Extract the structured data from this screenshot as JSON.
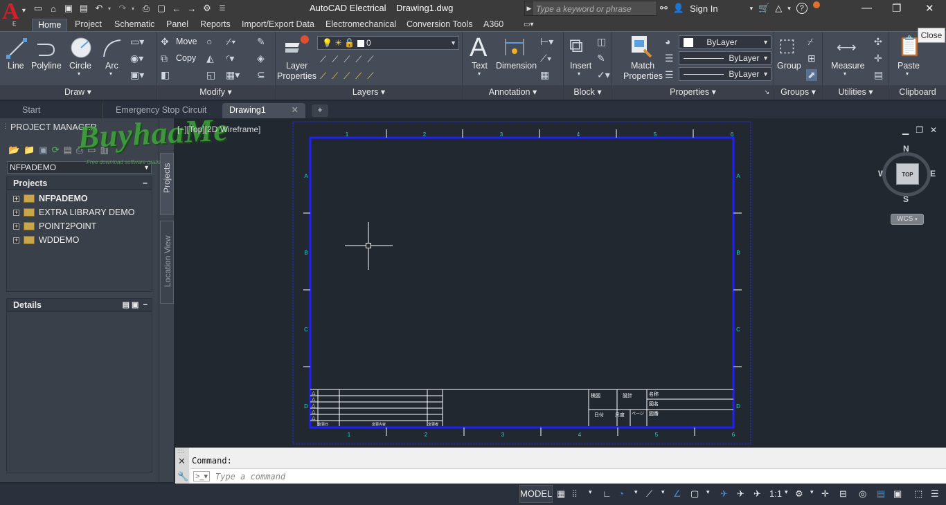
{
  "app": {
    "title": "AutoCAD Electrical    Drawing1.dwg",
    "logo_letter": "A",
    "logo_sub": "E"
  },
  "search": {
    "placeholder": "Type a keyword or phrase"
  },
  "user": {
    "sign_in": "Sign In"
  },
  "ribbon_tabs": [
    "Home",
    "Project",
    "Schematic",
    "Panel",
    "Reports",
    "Import/Export Data",
    "Electromechanical",
    "Conversion Tools",
    "A360"
  ],
  "ribbon": {
    "draw": {
      "title": "Draw",
      "line": "Line",
      "polyline": "Polyline",
      "circle": "Circle",
      "arc": "Arc"
    },
    "modify": {
      "title": "Modify",
      "move": "Move",
      "copy": "Copy"
    },
    "layers": {
      "title": "Layers",
      "layer_properties_1": "Layer",
      "layer_properties_2": "Properties",
      "current_layer": "0"
    },
    "annotation": {
      "title": "Annotation",
      "text": "Text",
      "dimension": "Dimension"
    },
    "block": {
      "title": "Block",
      "insert": "Insert"
    },
    "properties": {
      "title": "Properties",
      "match_1": "Match",
      "match_2": "Properties",
      "color": "ByLayer",
      "linetype": "ByLayer",
      "lineweight": "ByLayer"
    },
    "groups": {
      "title": "Groups",
      "group": "Group"
    },
    "utilities": {
      "title": "Utilities",
      "measure": "Measure"
    },
    "clipboard": {
      "title": "Clipboard",
      "paste": "Paste"
    },
    "close_tooltip": "Close"
  },
  "doc_tabs": [
    "Start",
    "Emergency Stop Circuit",
    "Drawing1"
  ],
  "project_manager": {
    "title": "PROJECT MANAGER",
    "selected_project": "NFPADEMO",
    "projects_header": "Projects",
    "projects": [
      "NFPADEMO",
      "EXTRA LIBRARY DEMO",
      "POINT2POINT",
      "WDDEMO"
    ],
    "details_header": "Details",
    "side_tab_projects": "Projects",
    "side_tab_location": "Location View"
  },
  "viewport": {
    "label": "[−][Top][2D Wireframe]",
    "viewcube_top": "TOP",
    "compass": {
      "n": "N",
      "s": "S",
      "e": "E",
      "w": "W"
    },
    "wcs": "WCS",
    "border_columns": [
      "1",
      "2",
      "3",
      "4",
      "5",
      "6"
    ],
    "border_rows": [
      "A",
      "B",
      "C",
      "D"
    ],
    "title_block": {
      "approved": "検図",
      "design": "設計",
      "name": "名称",
      "drawing_name": "図名",
      "date": "日付",
      "scale": "尺度",
      "page": "ページ",
      "number": "図番",
      "revision_symbols": [
        "△",
        "△",
        "△",
        "△",
        "△"
      ],
      "rev_headers": [
        "変更日",
        "変更内容",
        "変更者"
      ]
    }
  },
  "watermark": {
    "text": "BuyhaaMe",
    "sub": "Free download software gratis"
  },
  "command": {
    "history": "Command:",
    "placeholder": "Type a command"
  },
  "status": {
    "model": "MODEL",
    "scale": "1:1"
  }
}
